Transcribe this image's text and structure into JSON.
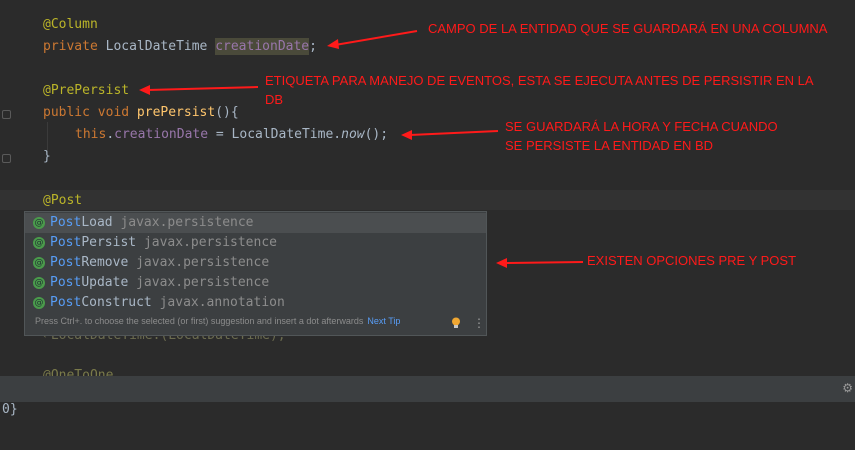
{
  "editor": {
    "lines": [
      {
        "id": "l1",
        "parts": [
          [
            "ann",
            "@Column"
          ]
        ]
      },
      {
        "id": "l2",
        "parts": [
          [
            "kw",
            "private "
          ],
          [
            "plain",
            "LocalDateTime "
          ],
          [
            "fldhl",
            "creationDate"
          ],
          [
            "plain",
            ";"
          ]
        ]
      },
      {
        "id": "l3",
        "parts": [
          [
            "ann",
            "@PrePersist"
          ]
        ]
      },
      {
        "id": "l4",
        "parts": [
          [
            "kw",
            "public void "
          ],
          [
            "fn",
            "prePersist"
          ],
          [
            "plain",
            "(){"
          ]
        ]
      },
      {
        "id": "l5",
        "parts": [
          [
            "kw",
            "this"
          ],
          [
            "plain",
            "."
          ],
          [
            "fld",
            "creationDate"
          ],
          [
            "plain",
            " = LocalDateTime."
          ],
          [
            "it",
            "now"
          ],
          [
            "plain",
            "();"
          ]
        ]
      },
      {
        "id": "l6",
        "parts": [
          [
            "plain",
            "}"
          ]
        ]
      },
      {
        "id": "l7",
        "parts": [
          [
            "ann",
            "@Post"
          ]
        ]
      }
    ],
    "hidden_partial_1": "←LocalDateTime.(LocalDateTime);",
    "hidden_partial_2": "@OneToOne",
    "console_text": "0}"
  },
  "annotations": {
    "note1": "CAMPO DE LA ENTIDAD QUE SE GUARDARÁ EN UNA COLUMNA",
    "note2_l1": "ETIQUETA PARA MANEJO DE EVENTOS, ESTA SE EJECUTA ANTES DE PERSISTIR EN LA",
    "note2_l2": "DB",
    "note3_l1": "SE GUARDARÁ LA HORA Y FECHA CUANDO",
    "note3_l2": "SE PERSISTE LA ENTIDAD EN BD",
    "note4": "EXISTEN OPCIONES PRE Y POST",
    "color": "#ff1a1a"
  },
  "completion": {
    "items": [
      {
        "match": "Post",
        "rest": "Load",
        "pkg": "javax.persistence",
        "selected": true
      },
      {
        "match": "Post",
        "rest": "Persist",
        "pkg": "javax.persistence",
        "selected": false
      },
      {
        "match": "Post",
        "rest": "Remove",
        "pkg": "javax.persistence",
        "selected": false
      },
      {
        "match": "Post",
        "rest": "Update",
        "pkg": "javax.persistence",
        "selected": false
      },
      {
        "match": "Post",
        "rest": "Construct",
        "pkg": "javax.annotation",
        "selected": false
      }
    ],
    "item_icon": "@",
    "footer_text": "Press Ctrl+. to choose the selected (or first) suggestion and insert a dot afterwards",
    "next_tip": "Next Tip",
    "more_icon": "⋮"
  },
  "bottom": {
    "gear_icon": "⚙"
  },
  "colors": {
    "background": "#2b2b2b",
    "annotation": "#bbb529",
    "keyword": "#cc7832",
    "function": "#ffc66d",
    "field": "#9876aa",
    "match": "#589df6",
    "arrow": "#ff1a1a"
  }
}
